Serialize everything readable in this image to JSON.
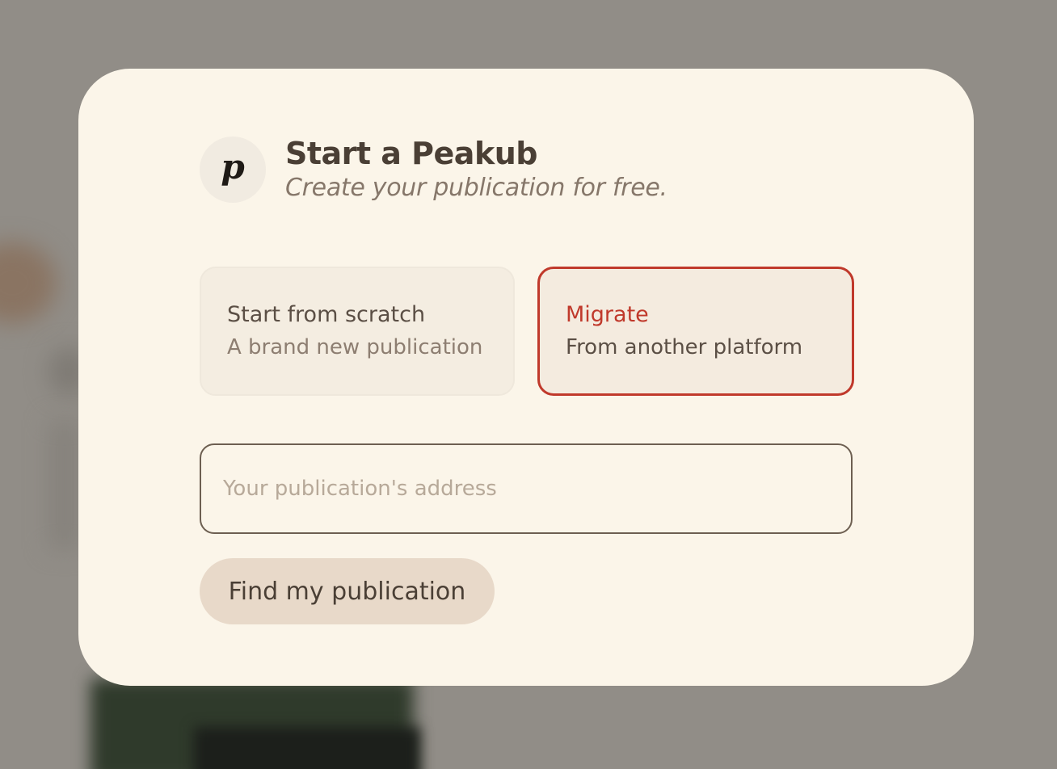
{
  "modal": {
    "logo_letter": "p",
    "title": "Start a Peakub",
    "subtitle": "Create your publication for free."
  },
  "options": [
    {
      "title": "Start from scratch",
      "description": "A brand new publication",
      "selected": false
    },
    {
      "title": "Migrate",
      "description": "From another platform",
      "selected": true
    }
  ],
  "address_field": {
    "value": "",
    "placeholder": "Your publication's address"
  },
  "find_button": {
    "label": "Find my publication"
  },
  "colors": {
    "accent": "#c0392b",
    "modal_background": "#fbf5e9",
    "button_background": "#e8d9c9",
    "overlay": "#918d87"
  }
}
